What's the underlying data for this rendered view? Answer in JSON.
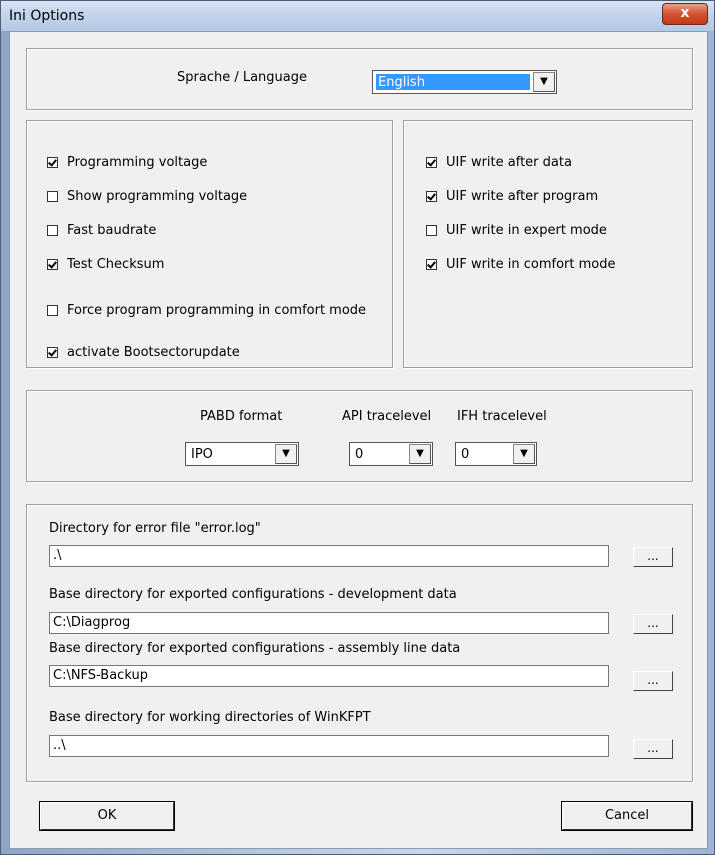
{
  "window": {
    "title": "Ini Options",
    "close_glyph": "x"
  },
  "language": {
    "label": "Sprache / Language",
    "value": "English",
    "arrow": "▼"
  },
  "options_left": [
    {
      "label": "Programming voltage",
      "checked": true
    },
    {
      "label": "Show programming voltage",
      "checked": false
    },
    {
      "label": "Fast baudrate",
      "checked": false
    },
    {
      "label": "Test Checksum",
      "checked": true
    },
    {
      "label": "Force program programming in comfort mode",
      "checked": false
    },
    {
      "label": "activate Bootsectorupdate",
      "checked": true
    }
  ],
  "options_right": [
    {
      "label": "UIF write after data",
      "checked": true
    },
    {
      "label": "UIF write after program",
      "checked": true
    },
    {
      "label": "UIF write in expert mode",
      "checked": false
    },
    {
      "label": "UIF write in comfort mode",
      "checked": true
    }
  ],
  "formats": {
    "pabd_label": "PABD format",
    "pabd_value": "IPO",
    "api_label": "API tracelevel",
    "api_value": "0",
    "ifh_label": "IFH tracelevel",
    "ifh_value": "0",
    "arrow": "▼"
  },
  "directories": [
    {
      "label": "Directory for error file \"error.log\"",
      "value": ".\\",
      "browse": "..."
    },
    {
      "label": "Base directory for exported configurations - development data",
      "value": "C:\\Diagprog",
      "browse": "..."
    },
    {
      "label": "Base directory for exported configurations - assembly line data",
      "value": "C:\\NFS-Backup",
      "browse": "..."
    },
    {
      "label": "Base directory for working directories of WinKFPT",
      "value": "..\\",
      "browse": "..."
    }
  ],
  "buttons": {
    "ok": "OK",
    "cancel": "Cancel"
  }
}
